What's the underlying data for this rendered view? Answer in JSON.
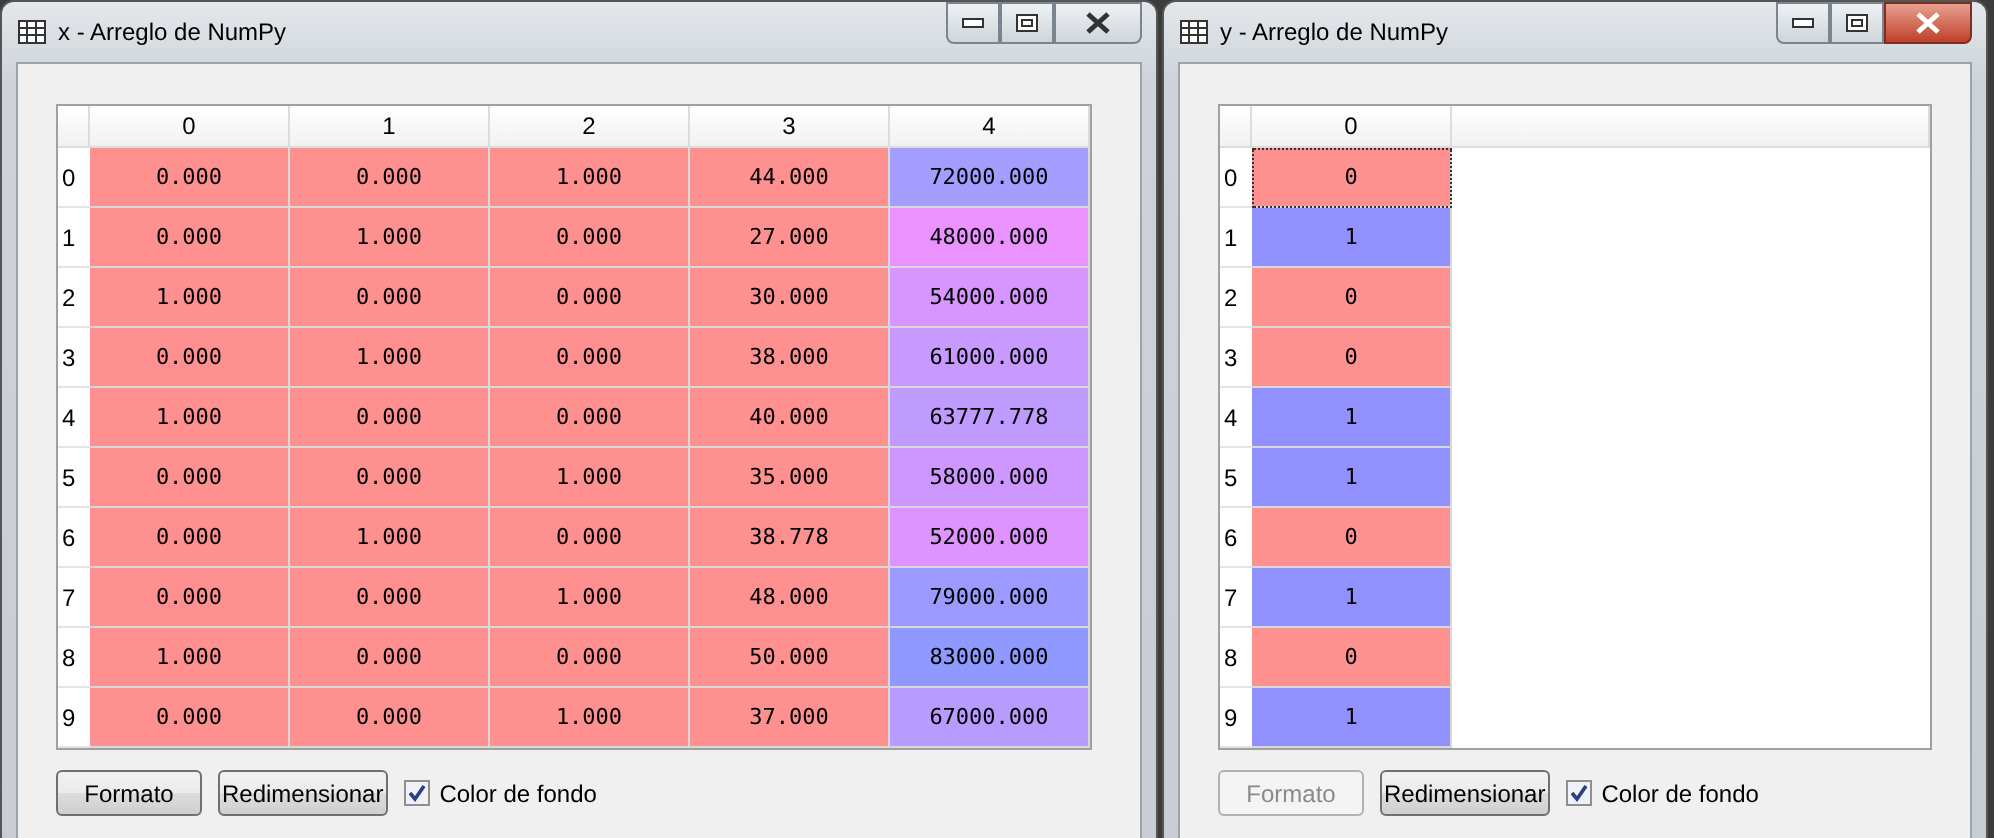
{
  "windows": [
    {
      "title": "x - Arreglo de NumPy",
      "active": false,
      "table": {
        "columns": [
          "0",
          "1",
          "2",
          "3",
          "4"
        ],
        "rows": [
          {
            "header": "0",
            "cells": [
              {
                "text": "0.000",
                "color": "#ff9090"
              },
              {
                "text": "0.000",
                "color": "#ff9090"
              },
              {
                "text": "1.000",
                "color": "#ff9090"
              },
              {
                "text": "44.000",
                "color": "#ff9090"
              },
              {
                "text": "72000.000",
                "color": "#a59cff"
              }
            ]
          },
          {
            "header": "1",
            "cells": [
              {
                "text": "0.000",
                "color": "#ff9090"
              },
              {
                "text": "1.000",
                "color": "#ff9090"
              },
              {
                "text": "0.000",
                "color": "#ff9090"
              },
              {
                "text": "27.000",
                "color": "#ff9090"
              },
              {
                "text": "48000.000",
                "color": "#ea92ff"
              }
            ]
          },
          {
            "header": "2",
            "cells": [
              {
                "text": "1.000",
                "color": "#ff9090"
              },
              {
                "text": "0.000",
                "color": "#ff9090"
              },
              {
                "text": "0.000",
                "color": "#ff9090"
              },
              {
                "text": "30.000",
                "color": "#ff9090"
              },
              {
                "text": "54000.000",
                "color": "#d796ff"
              }
            ]
          },
          {
            "header": "3",
            "cells": [
              {
                "text": "0.000",
                "color": "#ff9090"
              },
              {
                "text": "1.000",
                "color": "#ff9090"
              },
              {
                "text": "0.000",
                "color": "#ff9090"
              },
              {
                "text": "38.000",
                "color": "#ff9090"
              },
              {
                "text": "61000.000",
                "color": "#c89aff"
              }
            ]
          },
          {
            "header": "4",
            "cells": [
              {
                "text": "1.000",
                "color": "#ff9090"
              },
              {
                "text": "0.000",
                "color": "#ff9090"
              },
              {
                "text": "0.000",
                "color": "#ff9090"
              },
              {
                "text": "40.000",
                "color": "#ff9090"
              },
              {
                "text": "63777.778",
                "color": "#bf9bff"
              }
            ]
          },
          {
            "header": "5",
            "cells": [
              {
                "text": "0.000",
                "color": "#ff9090"
              },
              {
                "text": "0.000",
                "color": "#ff9090"
              },
              {
                "text": "1.000",
                "color": "#ff9090"
              },
              {
                "text": "35.000",
                "color": "#ff9090"
              },
              {
                "text": "58000.000",
                "color": "#cd97ff"
              }
            ]
          },
          {
            "header": "6",
            "cells": [
              {
                "text": "0.000",
                "color": "#ff9090"
              },
              {
                "text": "1.000",
                "color": "#ff9090"
              },
              {
                "text": "0.000",
                "color": "#ff9090"
              },
              {
                "text": "38.778",
                "color": "#ff9090"
              },
              {
                "text": "52000.000",
                "color": "#df93ff"
              }
            ]
          },
          {
            "header": "7",
            "cells": [
              {
                "text": "0.000",
                "color": "#ff9090"
              },
              {
                "text": "0.000",
                "color": "#ff9090"
              },
              {
                "text": "1.000",
                "color": "#ff9090"
              },
              {
                "text": "48.000",
                "color": "#ff9090"
              },
              {
                "text": "79000.000",
                "color": "#9d9aff"
              }
            ]
          },
          {
            "header": "8",
            "cells": [
              {
                "text": "1.000",
                "color": "#ff9090"
              },
              {
                "text": "0.000",
                "color": "#ff9090"
              },
              {
                "text": "0.000",
                "color": "#ff9090"
              },
              {
                "text": "50.000",
                "color": "#ff9090"
              },
              {
                "text": "83000.000",
                "color": "#9099ff"
              }
            ]
          },
          {
            "header": "9",
            "cells": [
              {
                "text": "0.000",
                "color": "#ff9090"
              },
              {
                "text": "0.000",
                "color": "#ff9090"
              },
              {
                "text": "1.000",
                "color": "#ff9090"
              },
              {
                "text": "37.000",
                "color": "#ff9090"
              },
              {
                "text": "67000.000",
                "color": "#b79bff"
              }
            ]
          }
        ]
      },
      "buttons": [
        {
          "label": "Formato",
          "disabled": false
        },
        {
          "label": "Redimensionar",
          "disabled": false
        }
      ],
      "checkbox": {
        "label": "Color de fondo",
        "checked": true
      }
    },
    {
      "title": "y - Arreglo de NumPy",
      "active": true,
      "table": {
        "columns": [
          "0"
        ],
        "rows": [
          {
            "header": "0",
            "cells": [
              {
                "text": "0",
                "color": "#ff9090",
                "focused": true
              }
            ]
          },
          {
            "header": "1",
            "cells": [
              {
                "text": "1",
                "color": "#9090ff",
                "focused": false
              }
            ]
          },
          {
            "header": "2",
            "cells": [
              {
                "text": "0",
                "color": "#ff9090",
                "focused": false
              }
            ]
          },
          {
            "header": "3",
            "cells": [
              {
                "text": "0",
                "color": "#ff9090",
                "focused": false
              }
            ]
          },
          {
            "header": "4",
            "cells": [
              {
                "text": "1",
                "color": "#9090ff",
                "focused": false
              }
            ]
          },
          {
            "header": "5",
            "cells": [
              {
                "text": "1",
                "color": "#9090ff",
                "focused": false
              }
            ]
          },
          {
            "header": "6",
            "cells": [
              {
                "text": "0",
                "color": "#ff9090",
                "focused": false
              }
            ]
          },
          {
            "header": "7",
            "cells": [
              {
                "text": "1",
                "color": "#9090ff",
                "focused": false
              }
            ]
          },
          {
            "header": "8",
            "cells": [
              {
                "text": "0",
                "color": "#ff9090",
                "focused": false
              }
            ]
          },
          {
            "header": "9",
            "cells": [
              {
                "text": "1",
                "color": "#9090ff",
                "focused": false
              }
            ]
          }
        ]
      },
      "buttons": [
        {
          "label": "Formato",
          "disabled": true
        },
        {
          "label": "Redimensionar",
          "disabled": false
        }
      ],
      "checkbox": {
        "label": "Color de fondo",
        "checked": true
      }
    }
  ]
}
